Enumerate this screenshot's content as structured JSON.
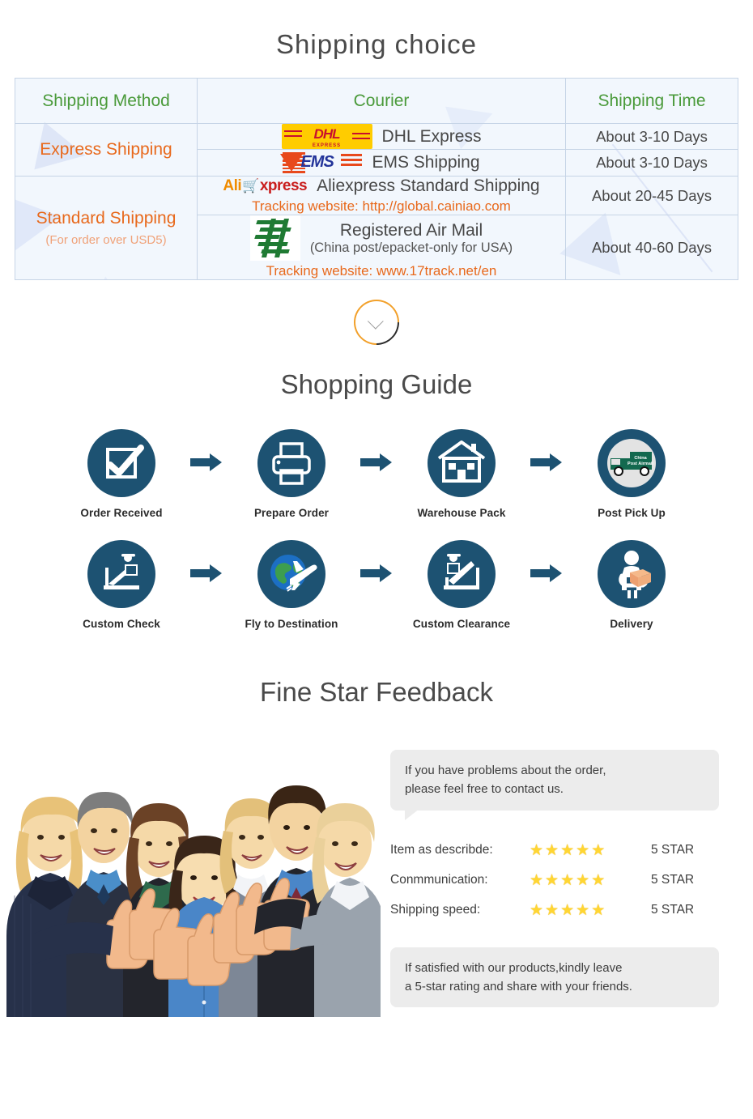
{
  "shipping": {
    "title": "Shipping choice",
    "headers": [
      "Shipping Method",
      "Courier",
      "Shipping Time"
    ],
    "methods": {
      "express": "Express Shipping",
      "standard": "Standard Shipping",
      "standard_note": "(For order over USD5)"
    },
    "rows": [
      {
        "logo": "dhl-logo",
        "courier": "DHL Express",
        "time": "About 3-10 Days"
      },
      {
        "logo": "ems-logo",
        "courier": "EMS Shipping",
        "time": "About 3-10 Days"
      },
      {
        "logo": "aliexpress-logo",
        "courier": "Aliexpress Standard Shipping",
        "tracking": "Tracking website: http://global.cainiao.com",
        "time": "About 20-45 Days"
      },
      {
        "logo": "china-post-logo",
        "courier": "Registered Air Mail",
        "courier_sub": "(China post/epacket-only for USA)",
        "tracking": "Tracking website: www.17track.net/en",
        "time": "About 40-60 Days"
      }
    ],
    "logo_text": {
      "dhl_main": "DHL",
      "dhl_sub": "EXPRESS",
      "ems_main": "EMS",
      "ali_part1": "Ali",
      "ali_cart": "🛒",
      "ali_part2": "xpress"
    }
  },
  "guide": {
    "title": "Shopping Guide",
    "row1": [
      {
        "icon": "checkbox-icon",
        "label": "Order Received"
      },
      {
        "icon": "printer-icon",
        "label": "Prepare Order"
      },
      {
        "icon": "warehouse-icon",
        "label": "Warehouse Pack"
      },
      {
        "icon": "post-truck-icon",
        "label": "Post Pick Up"
      }
    ],
    "row2": [
      {
        "icon": "customs-scan-icon",
        "label": "Custom Check"
      },
      {
        "icon": "globe-plane-icon",
        "label": "Fly to Destination"
      },
      {
        "icon": "customs-clearance-icon",
        "label": "Custom Clearance"
      },
      {
        "icon": "delivery-person-icon",
        "label": "Delivery"
      }
    ],
    "truck_text_line1": "China",
    "truck_text_line2": "Post Airmail"
  },
  "feedback": {
    "title": "Fine Star Feedback",
    "bubble_top": "If you have problems about the order,\nplease feel free to contact us.",
    "bubble_top_l1": "If you have problems about the order,",
    "bubble_top_l2": "please feel free to contact us.",
    "ratings": [
      {
        "label": "Item as describde:",
        "stars": 5,
        "value": "5 STAR"
      },
      {
        "label": "Conmmunication:",
        "stars": 5,
        "value": "5 STAR"
      },
      {
        "label": "Shipping speed:",
        "stars": 5,
        "value": "5 STAR"
      }
    ],
    "bubble_bottom_l1": "If satisfied with our products,kindly leave",
    "bubble_bottom_l2": "a 5-star rating and share with your friends.",
    "star_glyph": "★"
  },
  "colors": {
    "heading": "#4a4a4a",
    "table_header_green": "#4a9a3a",
    "method_orange": "#e8691c",
    "table_bg": "#f2f7fd",
    "badge_navy": "#1d5272",
    "star_yellow": "#ffd633",
    "accent_orange": "#f2a02a"
  }
}
